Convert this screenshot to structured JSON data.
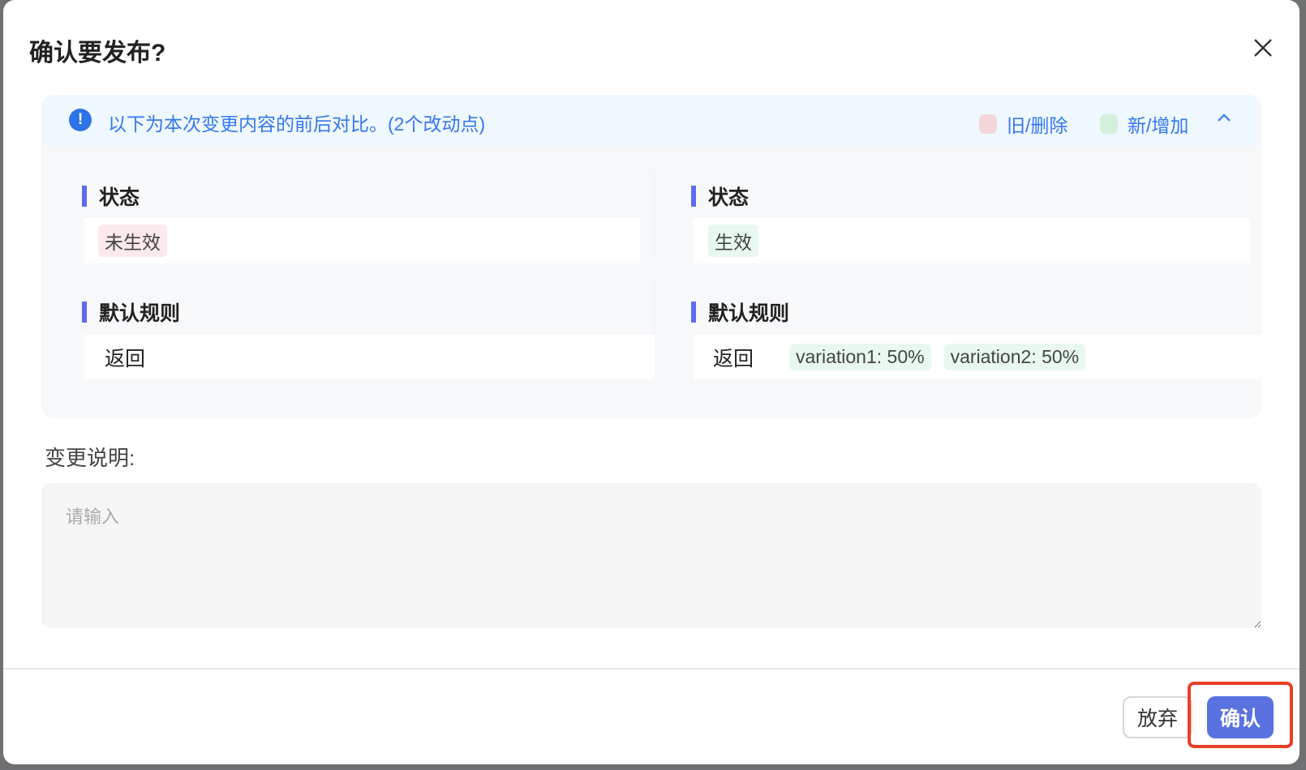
{
  "dialog": {
    "title": "确认要发布?"
  },
  "diff": {
    "notice": "以下为本次变更内容的前后对比。(2个改动点)",
    "legend_old": "旧/删除",
    "legend_new": "新/增加",
    "colors": {
      "old": "#f2d6d9",
      "new": "#d3f0dd",
      "accent": "#5c6bf0"
    },
    "old": {
      "status_title": "状态",
      "status_value": "未生效",
      "rule_title": "默认规则",
      "rule_return": "返回"
    },
    "new": {
      "status_title": "状态",
      "status_value": "生效",
      "rule_title": "默认规则",
      "rule_return": "返回",
      "variations": [
        "variation1: 50%",
        "variation2: 50%"
      ]
    }
  },
  "form": {
    "label": "变更说明:",
    "placeholder": "请输入"
  },
  "footer": {
    "cancel": "放弃",
    "confirm": "确认"
  }
}
